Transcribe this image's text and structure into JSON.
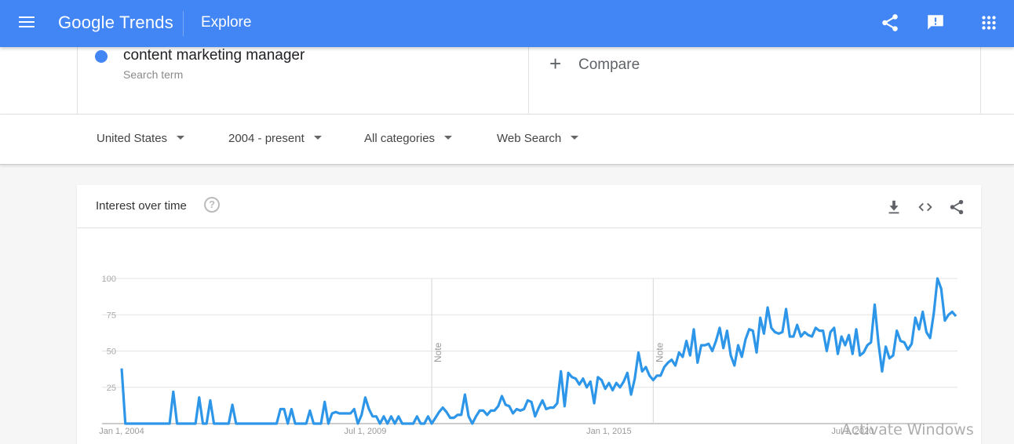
{
  "topbar": {
    "app_name": "Google Trends",
    "page_title": "Explore",
    "icons": [
      "menu-icon",
      "share-icon",
      "feedback-icon",
      "apps-grid-icon"
    ]
  },
  "search": {
    "term": "content marketing manager",
    "term_type": "Search term",
    "term_color": "#4285f4",
    "compare_label": "Compare"
  },
  "filters": {
    "region": "United States",
    "time_range": "2004 - present",
    "category": "All categories",
    "search_type": "Web Search"
  },
  "card": {
    "title": "Interest over time",
    "help_icon": "help-icon",
    "actions": [
      "download-icon",
      "embed-code-icon",
      "share-icon"
    ]
  },
  "chart_data": {
    "type": "line",
    "title": "Interest over time",
    "xlabel": "",
    "ylabel": "",
    "ylim": [
      0,
      100
    ],
    "yticks": [
      25,
      50,
      75,
      100
    ],
    "xtick_labels": [
      "Jan 1, 2004",
      "Jul 1, 2009",
      "Jan 1, 2015",
      "Jul 1, 2020"
    ],
    "xtick_month_index": [
      0,
      66,
      132,
      198
    ],
    "notes": [
      {
        "label": "Note",
        "month_index": 84
      },
      {
        "label": "Note",
        "month_index": 144
      }
    ],
    "grid": true,
    "legend": "none",
    "series_color": "#2d96e8",
    "series": [
      {
        "name": "content marketing manager",
        "start": "Jan 2004",
        "frequency": "monthly",
        "values": [
          38,
          0,
          0,
          0,
          0,
          0,
          0,
          0,
          0,
          0,
          0,
          0,
          0,
          0,
          22,
          0,
          0,
          0,
          0,
          0,
          0,
          18,
          0,
          0,
          16,
          0,
          0,
          0,
          0,
          0,
          13,
          0,
          0,
          0,
          0,
          0,
          0,
          0,
          0,
          0,
          0,
          0,
          0,
          10,
          10,
          0,
          10,
          0,
          0,
          0,
          0,
          9,
          0,
          0,
          0,
          15,
          0,
          7,
          8,
          7,
          7,
          7,
          7,
          10,
          0,
          6,
          18,
          10,
          5,
          5,
          0,
          5,
          0,
          5,
          0,
          5,
          0,
          0,
          0,
          0,
          5,
          0,
          0,
          5,
          0,
          4,
          8,
          11,
          8,
          4,
          4,
          6,
          6,
          20,
          5,
          0,
          5,
          9,
          9,
          6,
          9,
          9,
          12,
          19,
          13,
          12,
          7,
          10,
          9,
          10,
          16,
          15,
          5,
          11,
          16,
          10,
          11,
          11,
          14,
          36,
          12,
          35,
          32,
          31,
          27,
          31,
          25,
          29,
          14,
          32,
          30,
          24,
          28,
          23,
          28,
          25,
          29,
          35,
          20,
          31,
          49,
          36,
          39,
          33,
          30,
          33,
          33,
          39,
          42,
          44,
          40,
          49,
          46,
          57,
          47,
          65,
          42,
          54,
          54,
          55,
          50,
          57,
          66,
          52,
          64,
          47,
          40,
          54,
          46,
          58,
          65,
          64,
          49,
          73,
          62,
          80,
          66,
          63,
          62,
          63,
          79,
          60,
          60,
          68,
          60,
          63,
          61,
          60,
          66,
          64,
          64,
          50,
          63,
          66,
          48,
          60,
          54,
          61,
          48,
          65,
          47,
          49,
          54,
          56,
          82,
          56,
          36,
          53,
          45,
          47,
          64,
          57,
          56,
          51,
          55,
          73,
          65,
          77,
          63,
          59,
          76,
          100,
          93,
          71,
          75,
          77,
          74
        ]
      }
    ]
  }
}
